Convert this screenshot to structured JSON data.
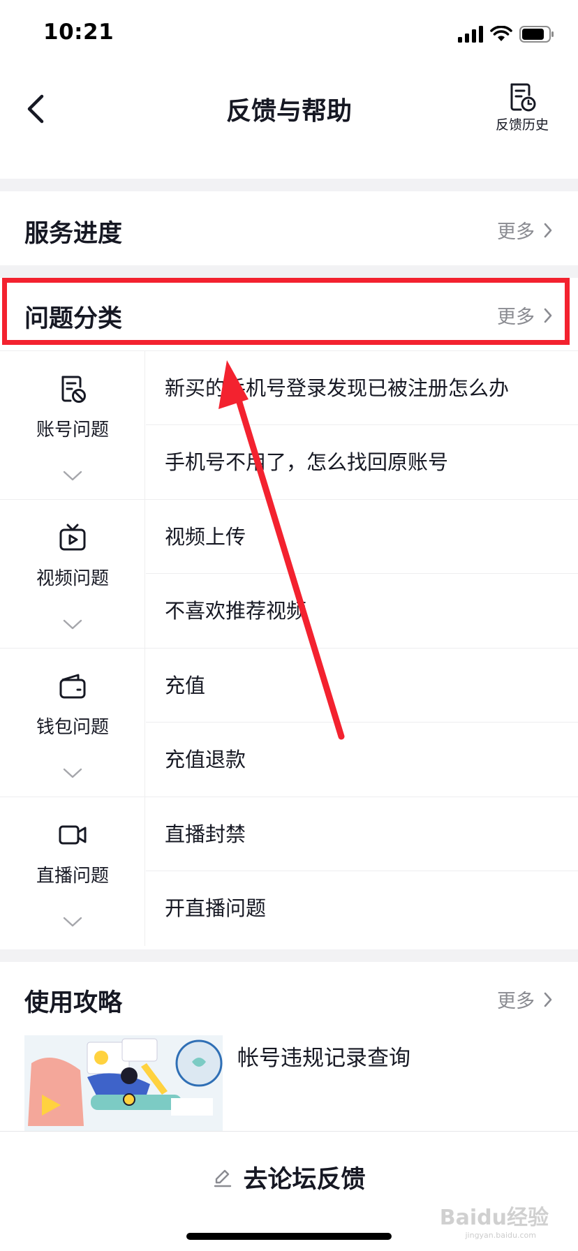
{
  "status_bar": {
    "time": "10:21"
  },
  "nav": {
    "title": "反馈与帮助",
    "history_label": "反馈历史"
  },
  "service_progress": {
    "title": "服务进度",
    "more_label": "更多"
  },
  "problem_categories": {
    "title": "问题分类",
    "more_label": "更多",
    "categories": [
      {
        "label": "账号问题",
        "icon": "account-doc-icon",
        "items": [
          "新买的手机号登录发现已被注册怎么办",
          "手机号不用了，怎么找回原账号"
        ]
      },
      {
        "label": "视频问题",
        "icon": "tv-play-icon",
        "items": [
          "视频上传",
          "不喜欢推荐视频"
        ]
      },
      {
        "label": "钱包问题",
        "icon": "wallet-icon",
        "items": [
          "充值",
          "充值退款"
        ]
      },
      {
        "label": "直播问题",
        "icon": "video-camera-icon",
        "items": [
          "直播封禁",
          "开直播问题"
        ]
      }
    ]
  },
  "guide": {
    "title": "使用攻略",
    "more_label": "更多",
    "articles": [
      {
        "title": "帐号违规记录查询"
      }
    ]
  },
  "bottom": {
    "button_label": "去论坛反馈"
  },
  "watermark": {
    "text": "Baidu经验",
    "sub": "jingyan.baidu.com"
  },
  "colors": {
    "highlight": "#f3222f",
    "divider": "#eeeeef",
    "section_gap": "#f2f2f4",
    "muted_text": "#8a8b91"
  }
}
